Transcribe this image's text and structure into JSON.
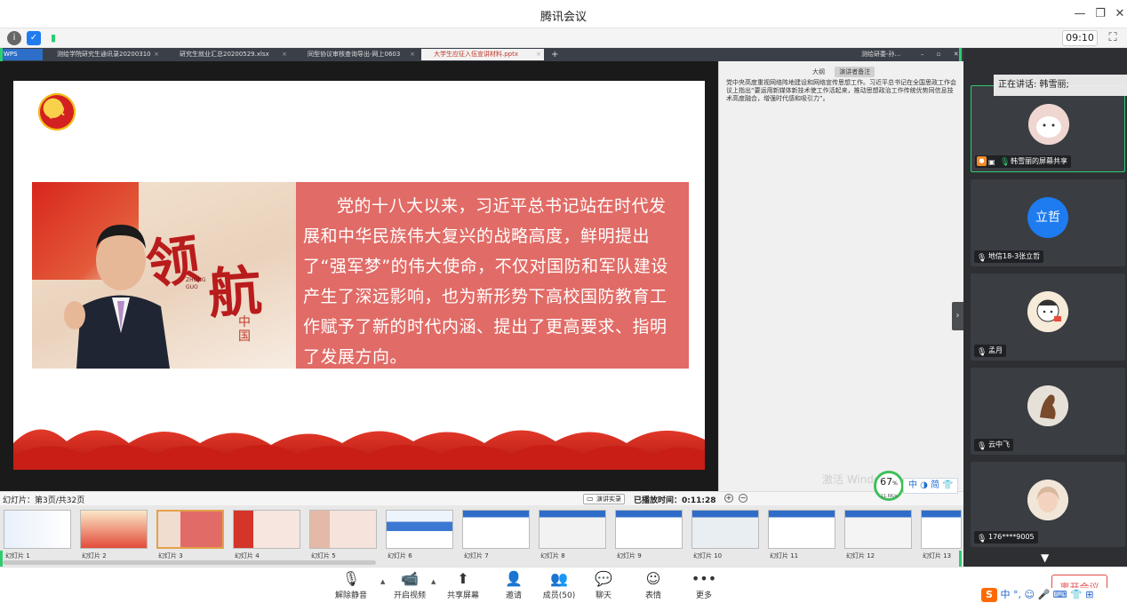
{
  "app": {
    "title": "腾讯会议",
    "time": "09:10"
  },
  "wps_tabs": [
    {
      "label": "WPS",
      "active": false
    },
    {
      "label": "测绘学院研究生通讯录20200310",
      "active": false
    },
    {
      "label": "研究生就业汇总20200529.xlsx",
      "active": false
    },
    {
      "label": "同型协议审核查询导出-网上0603",
      "active": false
    },
    {
      "label": "大学生应征入伍宣讲材料.pptx",
      "active": true
    }
  ],
  "wps_right_tab": "测绘研委-孙...",
  "slide": {
    "calligraphy_1": "领",
    "calligraphy_2": "航",
    "zhong_guo": "ZHONG GUO",
    "china_char": "中国",
    "text": "党的十八大以来，习近平总书记站在时代发展和中华民族伟大复兴的战略高度，鲜明提出了“强军梦”的伟大使命，不仅对国防和军队建设产生了深远影响，也为新形势下高校国防教育工作赋予了新的时代内涵、提出了更高要求、指明了发展方向。"
  },
  "notes": {
    "tab_outline": "大纲",
    "tab_notes": "演讲者备注",
    "text": "党中央高度重视网络阵地建设和网络宣传思想工作。习近平总书记在全国思政工作会议上指出“要运用新媒体新技术使工作活起来，推动思想政治工作传统优势同信息技术高度融合，增强时代感和吸引力”。"
  },
  "status": {
    "slide_count": "幻灯片：第3页/共32页",
    "speak_button": "演讲实录",
    "played_time": "已播放时间：0:11:28"
  },
  "thumbnails": [
    {
      "label": "幻灯片 1",
      "selected": false
    },
    {
      "label": "幻灯片 2",
      "selected": false
    },
    {
      "label": "幻灯片 3",
      "selected": true
    },
    {
      "label": "幻灯片 4",
      "selected": false
    },
    {
      "label": "幻灯片 5",
      "selected": false
    },
    {
      "label": "幻灯片 6",
      "selected": false
    },
    {
      "label": "幻灯片 7",
      "selected": false
    },
    {
      "label": "幻灯片 8",
      "selected": false
    },
    {
      "label": "幻灯片 9",
      "selected": false
    },
    {
      "label": "幻灯片 10",
      "selected": false
    },
    {
      "label": "幻灯片 11",
      "selected": false
    },
    {
      "label": "幻灯片 12",
      "selected": false
    },
    {
      "label": "幻灯片 13",
      "selected": false
    }
  ],
  "overlay": {
    "watermark": "激活 Windo",
    "badge_percent": "67",
    "badge_unit": "%",
    "badge_speed": "11.6K/s",
    "ime_text": "中 ◑ 简 👕"
  },
  "participants": {
    "speaking_label": "正在讲话: 韩雪丽;",
    "tiles": [
      {
        "name": "韩雪丽的屏幕共享",
        "avatar_text": "",
        "avatar_color": "#e8c8c8"
      },
      {
        "name": "地信18-3张立哲",
        "avatar_text": "立哲",
        "avatar_color": "#1e7bf0"
      },
      {
        "name": "孟月",
        "avatar_text": "",
        "avatar_color": "#f4e9d8"
      },
      {
        "name": "云中飞",
        "avatar_text": "",
        "avatar_color": "#e9dfd0"
      },
      {
        "name": "176****9005",
        "avatar_text": "",
        "avatar_color": "#efe3d6"
      }
    ]
  },
  "toolbar": {
    "mute": "解除静音",
    "video": "开启视频",
    "share": "共享屏幕",
    "invite": "邀请",
    "members": "成员(50)",
    "chat": "聊天",
    "reaction": "表情",
    "more": "更多",
    "leave": "离开会议"
  },
  "ime_tray": "中 °, ☺ 🎤 ⌨ 👕 ⊞"
}
